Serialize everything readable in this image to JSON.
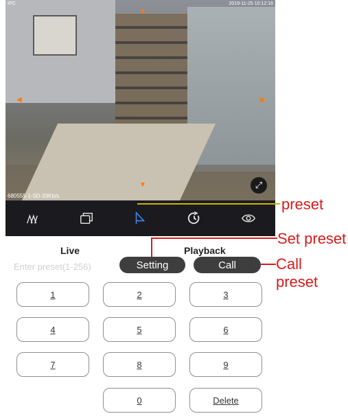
{
  "video": {
    "timestamp_left": "IPC",
    "timestamp_right": "2019-11-25 10:12:16",
    "stream_info": "680555-1-SD-33Kb/s"
  },
  "toolbar": {
    "icons": [
      "ptz-icon",
      "multi-window-icon",
      "preset-icon",
      "cruise-icon",
      "view-icon"
    ]
  },
  "annotations": {
    "preset": "preset",
    "set_preset": "Set preset",
    "call_preset": "Call preset"
  },
  "tabs": {
    "live": "Live",
    "playback": "Playback"
  },
  "preset_input": {
    "placeholder": "Enter preset(1-256)"
  },
  "buttons": {
    "setting": "Setting",
    "call": "Call"
  },
  "keypad": {
    "keys": [
      "1",
      "2",
      "3",
      "4",
      "5",
      "6",
      "7",
      "8",
      "9",
      "0",
      "Delete"
    ]
  },
  "colors": {
    "annotation_red": "#d91a1a",
    "annotation_yellow": "#d4b200",
    "button_dark": "#3e3e3e",
    "toolbar_bg": "#1b1b1f",
    "preset_icon_blue": "#3d8df5"
  }
}
